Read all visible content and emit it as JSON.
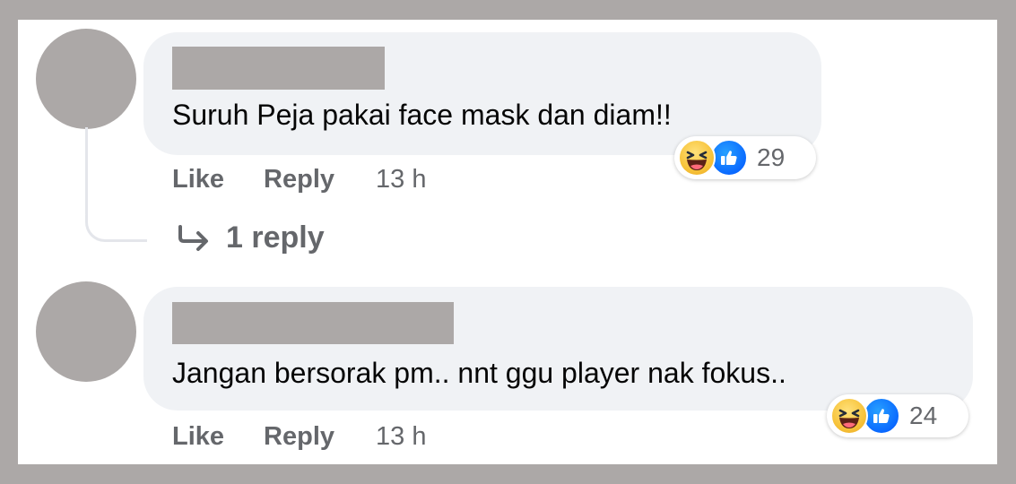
{
  "comments": [
    {
      "text": "Suruh Peja pakai face mask dan diam!!",
      "reaction_count": "29",
      "actions": {
        "like": "Like",
        "reply": "Reply",
        "time": "13 h"
      },
      "replies_link": "1 reply"
    },
    {
      "text": "Jangan bersorak pm.. nnt ggu player nak fokus..",
      "reaction_count": "24",
      "actions": {
        "like": "Like",
        "reply": "Reply",
        "time": "13 h"
      }
    }
  ],
  "icons": {
    "reply_arrow": "reply-arrow-icon",
    "haha": "haha-reaction-icon",
    "like": "like-reaction-icon"
  },
  "colors": {
    "frame_gray": "#aca8a7",
    "bubble_bg": "#f0f2f5",
    "meta_text": "#65676b",
    "like_blue": "#0866ff",
    "haha_yellow": "#f7c33a"
  }
}
